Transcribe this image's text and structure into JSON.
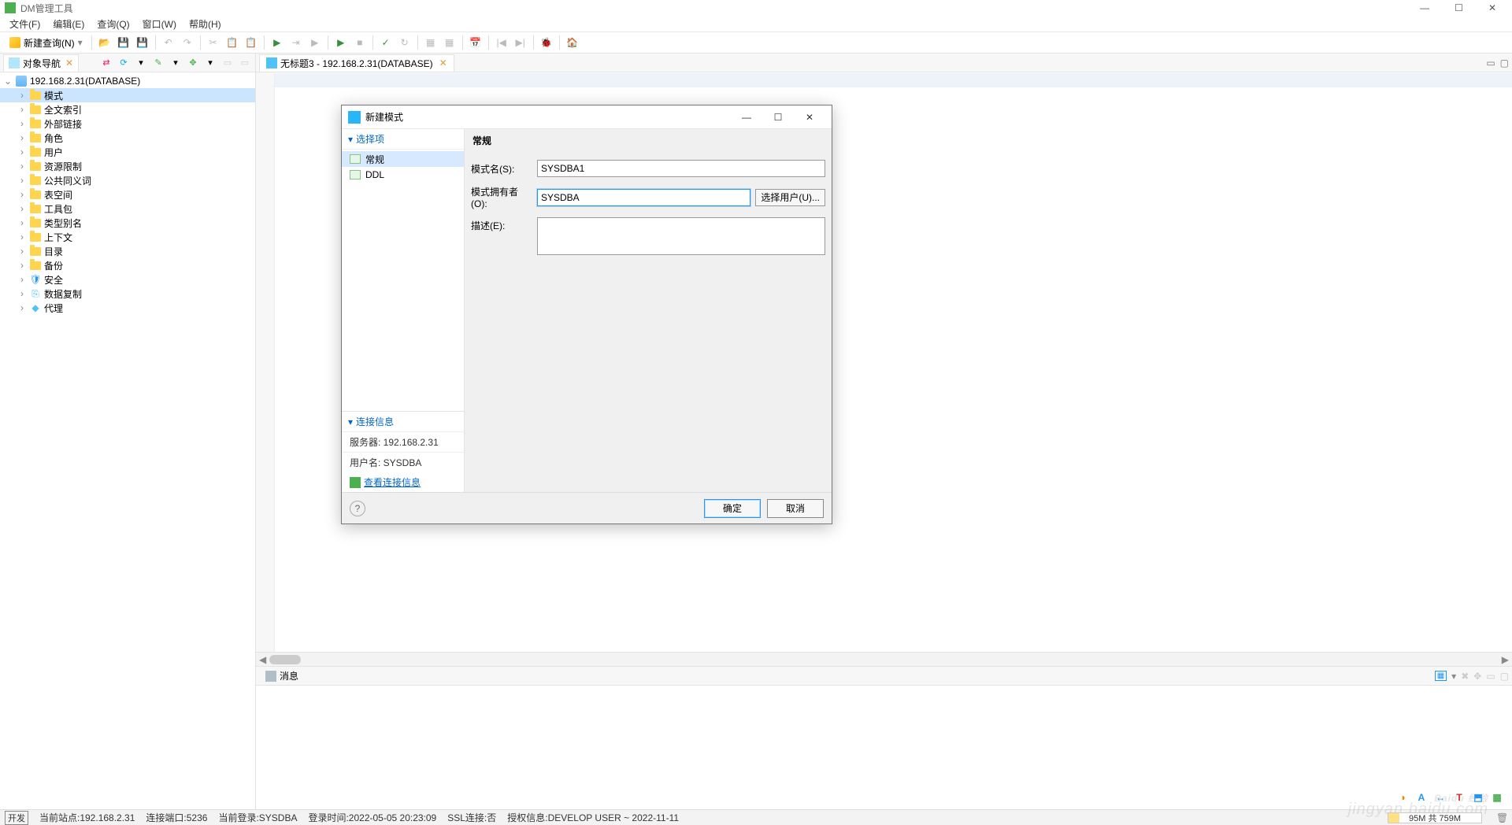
{
  "window": {
    "title": "DM管理工具"
  },
  "win_controls": {
    "min": "—",
    "max": "☐",
    "close": "✕"
  },
  "menu": {
    "file": "文件(F)",
    "edit": "编辑(E)",
    "query": "查询(Q)",
    "window": "窗口(W)",
    "help": "帮助(H)"
  },
  "toolbar": {
    "new_query": "新建查询(N)"
  },
  "nav": {
    "title": "对象导航",
    "close_x": "✕",
    "root": "192.168.2.31(DATABASE)",
    "items": [
      "模式",
      "全文索引",
      "外部链接",
      "角色",
      "用户",
      "资源限制",
      "公共同义词",
      "表空间",
      "工具包",
      "类型别名",
      "上下文",
      "目录",
      "备份",
      "安全",
      "数据复制",
      "代理"
    ]
  },
  "editor": {
    "tab": "无标题3 - 192.168.2.31(DATABASE)",
    "tab_x": "✕"
  },
  "msg": {
    "tab": "消息"
  },
  "dialog": {
    "title": "新建模式",
    "sections": {
      "choose": "选择项",
      "conn": "连接信息"
    },
    "list": {
      "general": "常规",
      "ddl": "DDL"
    },
    "header": "常规",
    "form": {
      "name_label": "模式名(S):",
      "name_value": "SYSDBA1",
      "owner_label": "模式拥有者(O):",
      "owner_value": "SYSDBA",
      "owner_btn": "选择用户(U)...",
      "desc_label": "描述(E):",
      "desc_value": ""
    },
    "conn": {
      "server_label": "服务器: ",
      "server": "192.168.2.31",
      "user_label": "用户名: ",
      "user": "SYSDBA",
      "link": "查看连接信息"
    },
    "footer": {
      "help": "?",
      "ok": "确定",
      "cancel": "取消"
    }
  },
  "status": {
    "dev": "开发",
    "items": [
      "当前站点:192.168.2.31",
      "连接端口:5236",
      "当前登录:SYSDBA",
      "登录时间:2022-05-05 20:23:09",
      "SSL连接:否",
      "授权信息:DEVELOP USER ~ 2022-11-11"
    ],
    "mem": "95M 共 759M"
  },
  "watermark": {
    "main": "Baidu 经验",
    "sub": "jingyan.baidu.com"
  }
}
